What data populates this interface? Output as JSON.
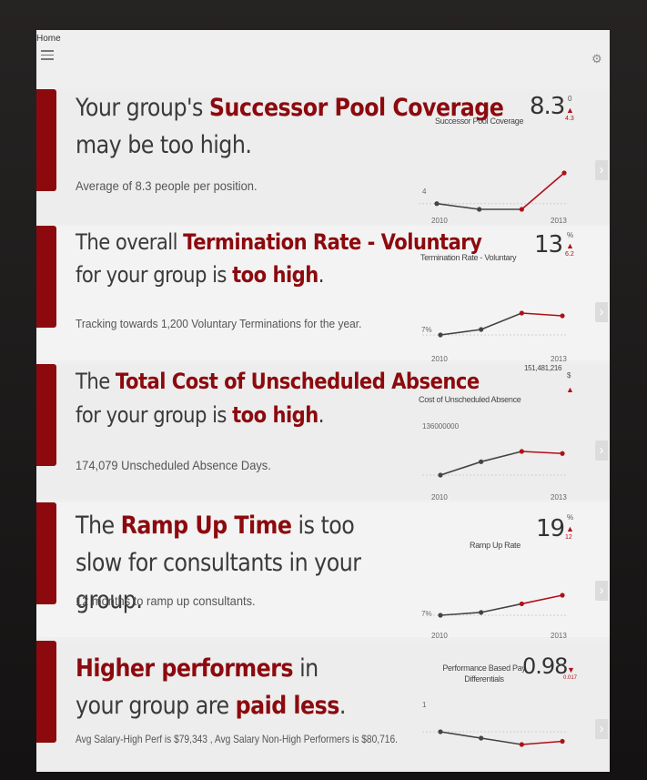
{
  "nav": {
    "home": "Home"
  },
  "cards": [
    {
      "headline": {
        "pre": "Your group's ",
        "hl1": "Successor Pool Coverage",
        "mid": " may be too high.",
        "hl2": "",
        "post": ""
      },
      "sub": "Average of 8.3 people per position.",
      "metric": {
        "label": "Successor Pool Coverage",
        "value": "8.3",
        "unit": "0",
        "delta": "4.3",
        "trend": "up",
        "ref": "4",
        "start_year": "2010",
        "end_year": "2013",
        "points": [
          4,
          3.2,
          3.2,
          8.3
        ]
      }
    },
    {
      "headline": {
        "pre": "The overall ",
        "hl1": "Termination Rate - Voluntary",
        "mid": " for your group is ",
        "hl2": "too high",
        "post": "."
      },
      "sub": "Tracking towards 1,200 Voluntary Terminations for the year.",
      "metric": {
        "label": "Termination Rate - Voluntary",
        "value": "13",
        "unit": "%",
        "delta": "6.2",
        "trend": "up",
        "ref": "7%",
        "start_year": "2010",
        "end_year": "2013",
        "points": [
          7,
          8,
          11,
          10.5
        ]
      }
    },
    {
      "headline": {
        "pre": "The ",
        "hl1": "Total Cost of Unscheduled Absence",
        "mid": " for your group is ",
        "hl2": "too high",
        "post": "."
      },
      "sub": "174,079 Unscheduled Absence Days.",
      "metric": {
        "label": "Cost of Unscheduled Absence",
        "value": "151,481,216",
        "unit": "$",
        "delta": "",
        "trend": "up",
        "ref": "136000000",
        "start_year": "2010",
        "end_year": "2013",
        "points": [
          125,
          138,
          148,
          146
        ]
      }
    },
    {
      "headline": {
        "pre": "The ",
        "hl1": "Ramp Up Time",
        "mid": " is ",
        "hl2": "too slow",
        "post": " for consultants in your group."
      },
      "sub": "12 months to ramp up consultants.",
      "metric": {
        "label": "Ramp Up Rate",
        "value": "19",
        "unit": "%",
        "delta": "12",
        "trend": "up",
        "ref": "7%",
        "start_year": "2010",
        "end_year": "2013",
        "points": [
          7,
          8,
          11,
          14
        ]
      }
    },
    {
      "headline": {
        "pre": "",
        "hl1": "Higher performers",
        "mid": " in your group are ",
        "hl2": "paid less",
        "post": "."
      },
      "sub": "Avg Salary-High Perf is $79,343 , Avg Salary Non-High Performers is $80,716.",
      "metric": {
        "label": "Performance Based Pay Differentials",
        "value": "0.98",
        "unit": "",
        "delta": "0.017",
        "trend": "down",
        "ref": "1",
        "start_year": "2010",
        "end_year": "2013",
        "points": [
          1,
          0.99,
          0.98,
          0.985
        ]
      }
    }
  ],
  "colors": {
    "accent": "#8c0a0e",
    "line_old": "#444444",
    "line_new": "#b0101a"
  }
}
